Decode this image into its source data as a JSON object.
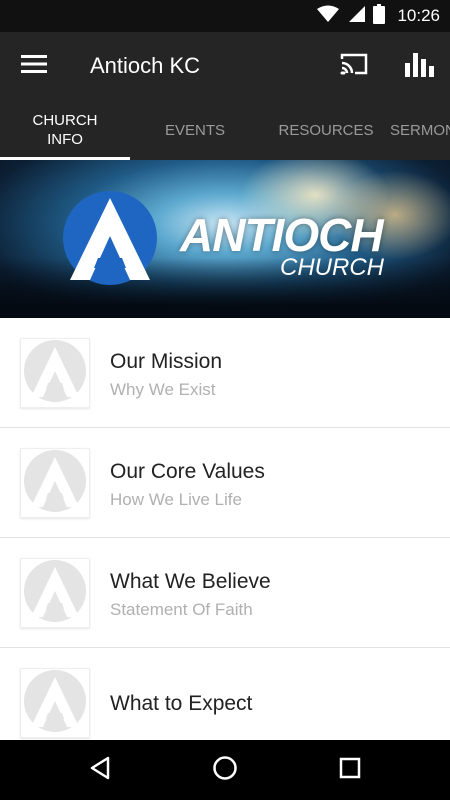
{
  "status_bar": {
    "time": "10:26",
    "icons": [
      "wifi-icon",
      "signal-icon",
      "battery-icon"
    ]
  },
  "app_bar": {
    "title": "Antioch KC",
    "icons": [
      "menu-icon",
      "cast-icon",
      "stats-icon"
    ]
  },
  "tabs": [
    {
      "label": "CHURCH\nINFO",
      "active": true
    },
    {
      "label": "EVENTS",
      "active": false
    },
    {
      "label": "RESOURCES",
      "active": false
    },
    {
      "label": "SERMONS",
      "active": false
    }
  ],
  "banner": {
    "brand": "ANTIOCH",
    "sub": "CHURCH"
  },
  "items": [
    {
      "title": "Our Mission",
      "subtitle": "Why We Exist"
    },
    {
      "title": "Our Core Values",
      "subtitle": "How We Live Life"
    },
    {
      "title": "What We Believe",
      "subtitle": "Statement Of Faith"
    },
    {
      "title": "What to Expect",
      "subtitle": ""
    }
  ],
  "nav_bar": {
    "icons": [
      "back-icon",
      "home-icon",
      "recents-icon"
    ]
  },
  "colors": {
    "app_bar": "#252525",
    "status_bar": "#111111",
    "brand_blue": "#1f66c2",
    "subtitle": "#b0b0b0"
  }
}
